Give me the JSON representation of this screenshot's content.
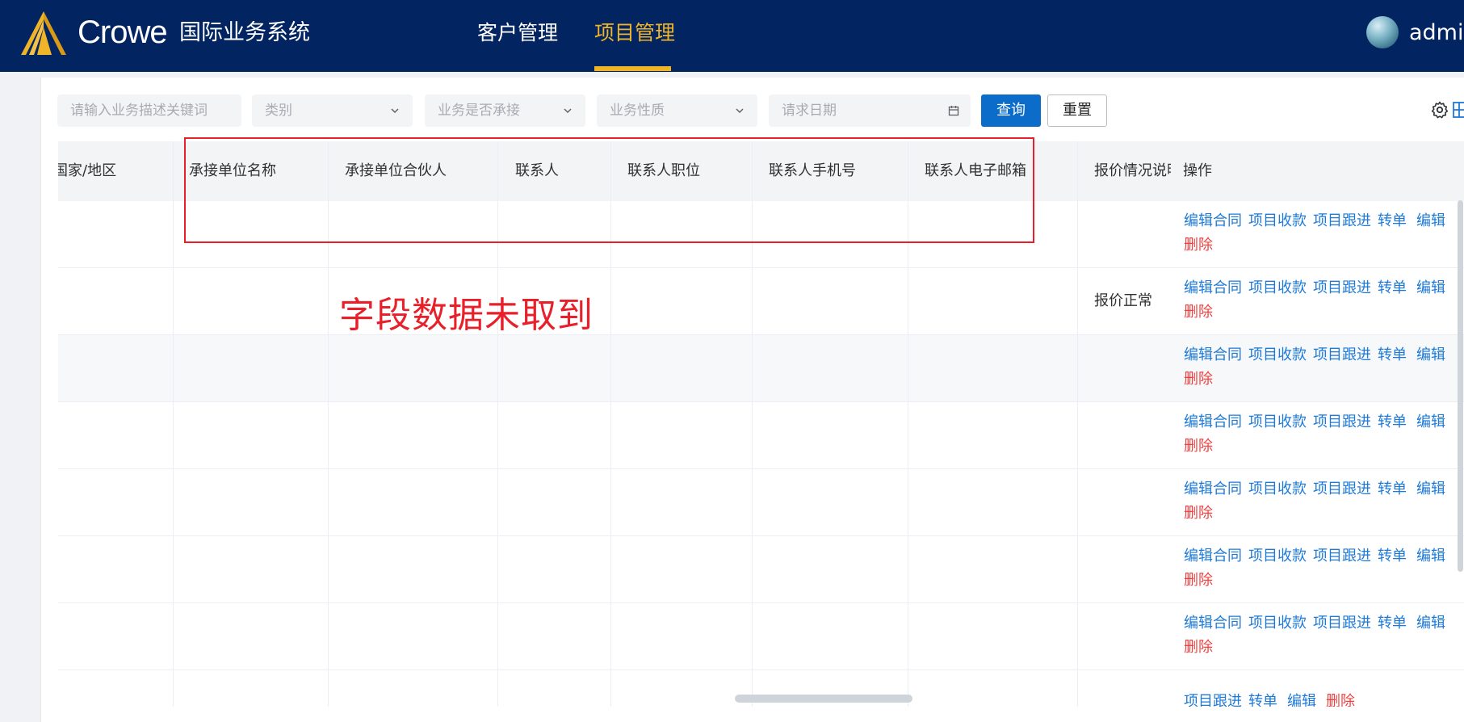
{
  "nav": {
    "brand": "Crowe",
    "system_name": "国际业务系统",
    "menu": [
      "客户管理",
      "项目管理"
    ],
    "username": "admin",
    "accent_color": "#f0b429",
    "bg_color": "#022461"
  },
  "filters": {
    "keyword_placeholder": "请输入业务描述关键词",
    "category_placeholder": "类别",
    "accepted_placeholder": "业务是否承接",
    "nature_placeholder": "业务性质",
    "date_placeholder": "请求日期",
    "search_label": "查询",
    "reset_label": "重置"
  },
  "table": {
    "columns": [
      "国家/地区",
      "承接单位名称",
      "承接单位合伙人",
      "联系人",
      "联系人职位",
      "联系人手机号",
      "联系人电子邮箱",
      "报价情况说明",
      "操作"
    ],
    "quote_values": [
      "",
      "报价正常",
      "",
      "",
      "",
      "",
      "",
      ""
    ],
    "actions": {
      "edit_contract": "编辑合同",
      "collect": "项目收款",
      "follow": "项目跟进",
      "transfer": "转单",
      "edit": "编辑",
      "delete": "删除"
    }
  },
  "annotation": {
    "text": "字段数据未取到",
    "color": "#e8202a"
  }
}
